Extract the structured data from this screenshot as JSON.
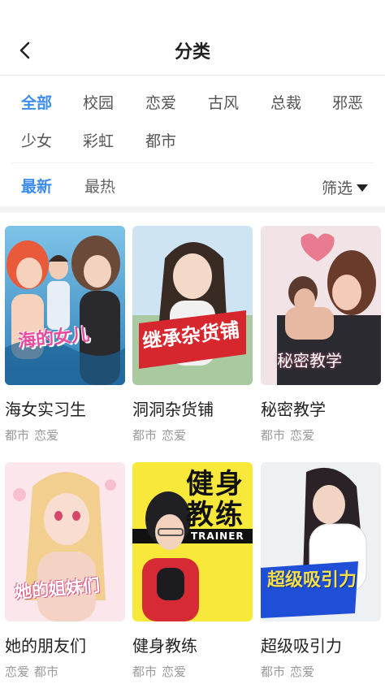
{
  "header": {
    "title": "分类"
  },
  "categories": [
    "全部",
    "校园",
    "恋爱",
    "古风",
    "总裁",
    "邪恶",
    "少女",
    "彩虹",
    "都市"
  ],
  "sort": {
    "options": [
      "最新",
      "最热"
    ],
    "filter_label": "筛选"
  },
  "comics": [
    {
      "title": "海女实习生",
      "tags": [
        "都市",
        "恋爱"
      ],
      "cover_text": "海的女儿"
    },
    {
      "title": "洞洞杂货铺",
      "tags": [
        "都市",
        "恋爱"
      ],
      "cover_text": "继承杂货铺"
    },
    {
      "title": "秘密教学",
      "tags": [
        "都市",
        "恋爱"
      ],
      "cover_text": "秘密教学"
    },
    {
      "title": "她的朋友们",
      "tags": [
        "恋爱",
        "都市"
      ],
      "cover_text": "她的姐妹们"
    },
    {
      "title": "健身教练",
      "tags": [
        "都市",
        "恋爱"
      ],
      "cover_text": "健身教练",
      "cover_subtext": "TRAINER"
    },
    {
      "title": "超级吸引力",
      "tags": [
        "都市",
        "恋爱"
      ],
      "cover_text": "超级吸引力"
    }
  ],
  "colors": {
    "accent": "#3b8cf0",
    "muted": "#999999"
  }
}
